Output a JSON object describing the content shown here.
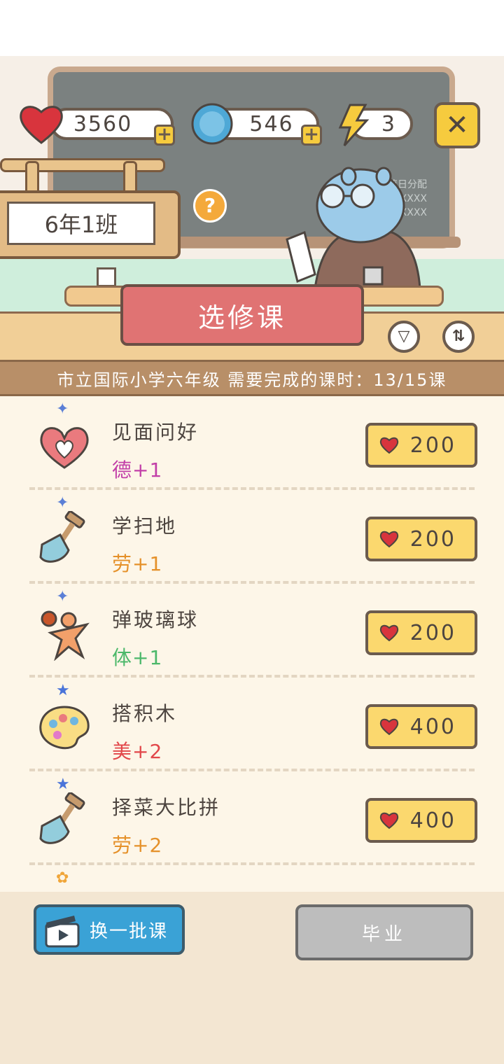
{
  "hud": {
    "hearts": "3560",
    "coins": "546",
    "energy": "3"
  },
  "class_sign": "6年1班",
  "board_notes": [
    "值日分配",
    "XXXX",
    "XXXXXX"
  ],
  "banner_title": "选修课",
  "info_text": "市立国际小学六年级  需要完成的课时：13/15课",
  "courses": [
    {
      "name": "见面问好",
      "stat": "德+1",
      "stat_color": "#c23fa8",
      "price": "200",
      "icon": "heart-hands-icon",
      "star": "diamond-star-icon"
    },
    {
      "name": "学扫地",
      "stat": "劳+1",
      "stat_color": "#e5912a",
      "price": "200",
      "icon": "shovel-icon",
      "star": "diamond-star-icon"
    },
    {
      "name": "弹玻璃球",
      "stat": "体+1",
      "stat_color": "#4cb86a",
      "price": "200",
      "icon": "ball-kid-icon",
      "star": "diamond-star-icon"
    },
    {
      "name": "搭积木",
      "stat": "美+2",
      "stat_color": "#e2474a",
      "price": "400",
      "icon": "palette-icon",
      "star": "blue-star-icon"
    },
    {
      "name": "择菜大比拼",
      "stat": "劳+2",
      "stat_color": "#e5912a",
      "price": "400",
      "icon": "shovel-icon",
      "star": "blue-star-icon"
    }
  ],
  "buttons": {
    "swap": "换一批课",
    "graduate": "毕业"
  },
  "colors": {
    "heart": "#d8343d",
    "gold": "#f6cb3e",
    "banner": "#e07373",
    "swap_button": "#3aa2d6"
  }
}
